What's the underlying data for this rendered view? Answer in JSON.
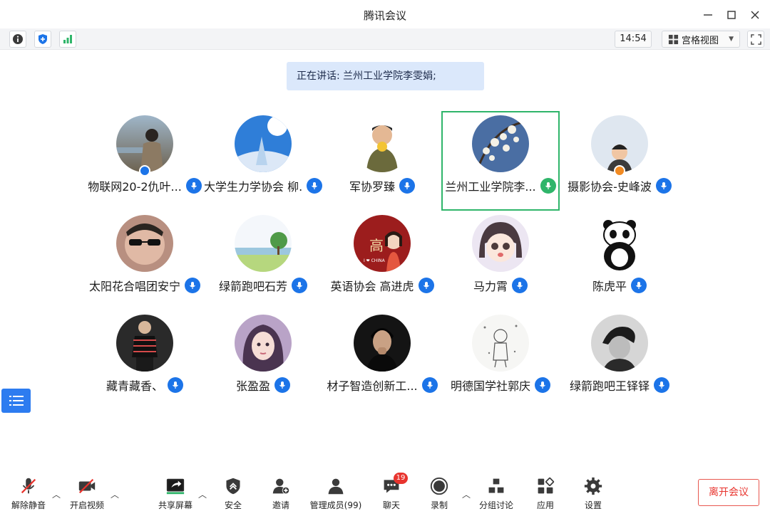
{
  "window": {
    "title": "腾讯会议"
  },
  "toolbar": {
    "time": "14:54",
    "view_label": "宫格视图"
  },
  "speaking": {
    "text": "正在讲话: 兰州工业学院李雯娟;"
  },
  "participants": [
    {
      "name": "物联网20-2仇叶...",
      "mic": "on"
    },
    {
      "name": "大学生力学协会 柳...",
      "mic": "on"
    },
    {
      "name": "军协罗臻",
      "mic": "on"
    },
    {
      "name": "兰州工业学院李...",
      "mic": "speaking"
    },
    {
      "name": "摄影协会-史峰波",
      "mic": "on"
    },
    {
      "name": "太阳花合唱团安宁",
      "mic": "on"
    },
    {
      "name": "绿箭跑吧石芳",
      "mic": "on"
    },
    {
      "name": "英语协会  高进虎",
      "mic": "on"
    },
    {
      "name": "马力霄",
      "mic": "on"
    },
    {
      "name": "陈虎平",
      "mic": "on"
    },
    {
      "name": "藏青藏香、",
      "mic": "on"
    },
    {
      "name": "张盈盈",
      "mic": "on"
    },
    {
      "name": "材子智造创新工...",
      "mic": "on"
    },
    {
      "name": "明德国学社郭庆",
      "mic": "on"
    },
    {
      "name": "绿箭跑吧王铎铎",
      "mic": "on"
    }
  ],
  "avatar_labels": {
    "china": "I ❤ CHINA",
    "gao": "高"
  },
  "bottom": {
    "unmute": "解除静音",
    "video": "开启视频",
    "share": "共享屏幕",
    "security": "安全",
    "invite": "邀请",
    "members": "管理成员(99)",
    "chat": "聊天",
    "chat_count": "19",
    "record": "录制",
    "breakout": "分组讨论",
    "apps": "应用",
    "settings": "设置",
    "leave": "离开会议"
  },
  "colors": {
    "accent": "#1c74e8",
    "speaking": "#2fb56a",
    "leave": "#e8342e",
    "banner": "#dbe8fb"
  }
}
